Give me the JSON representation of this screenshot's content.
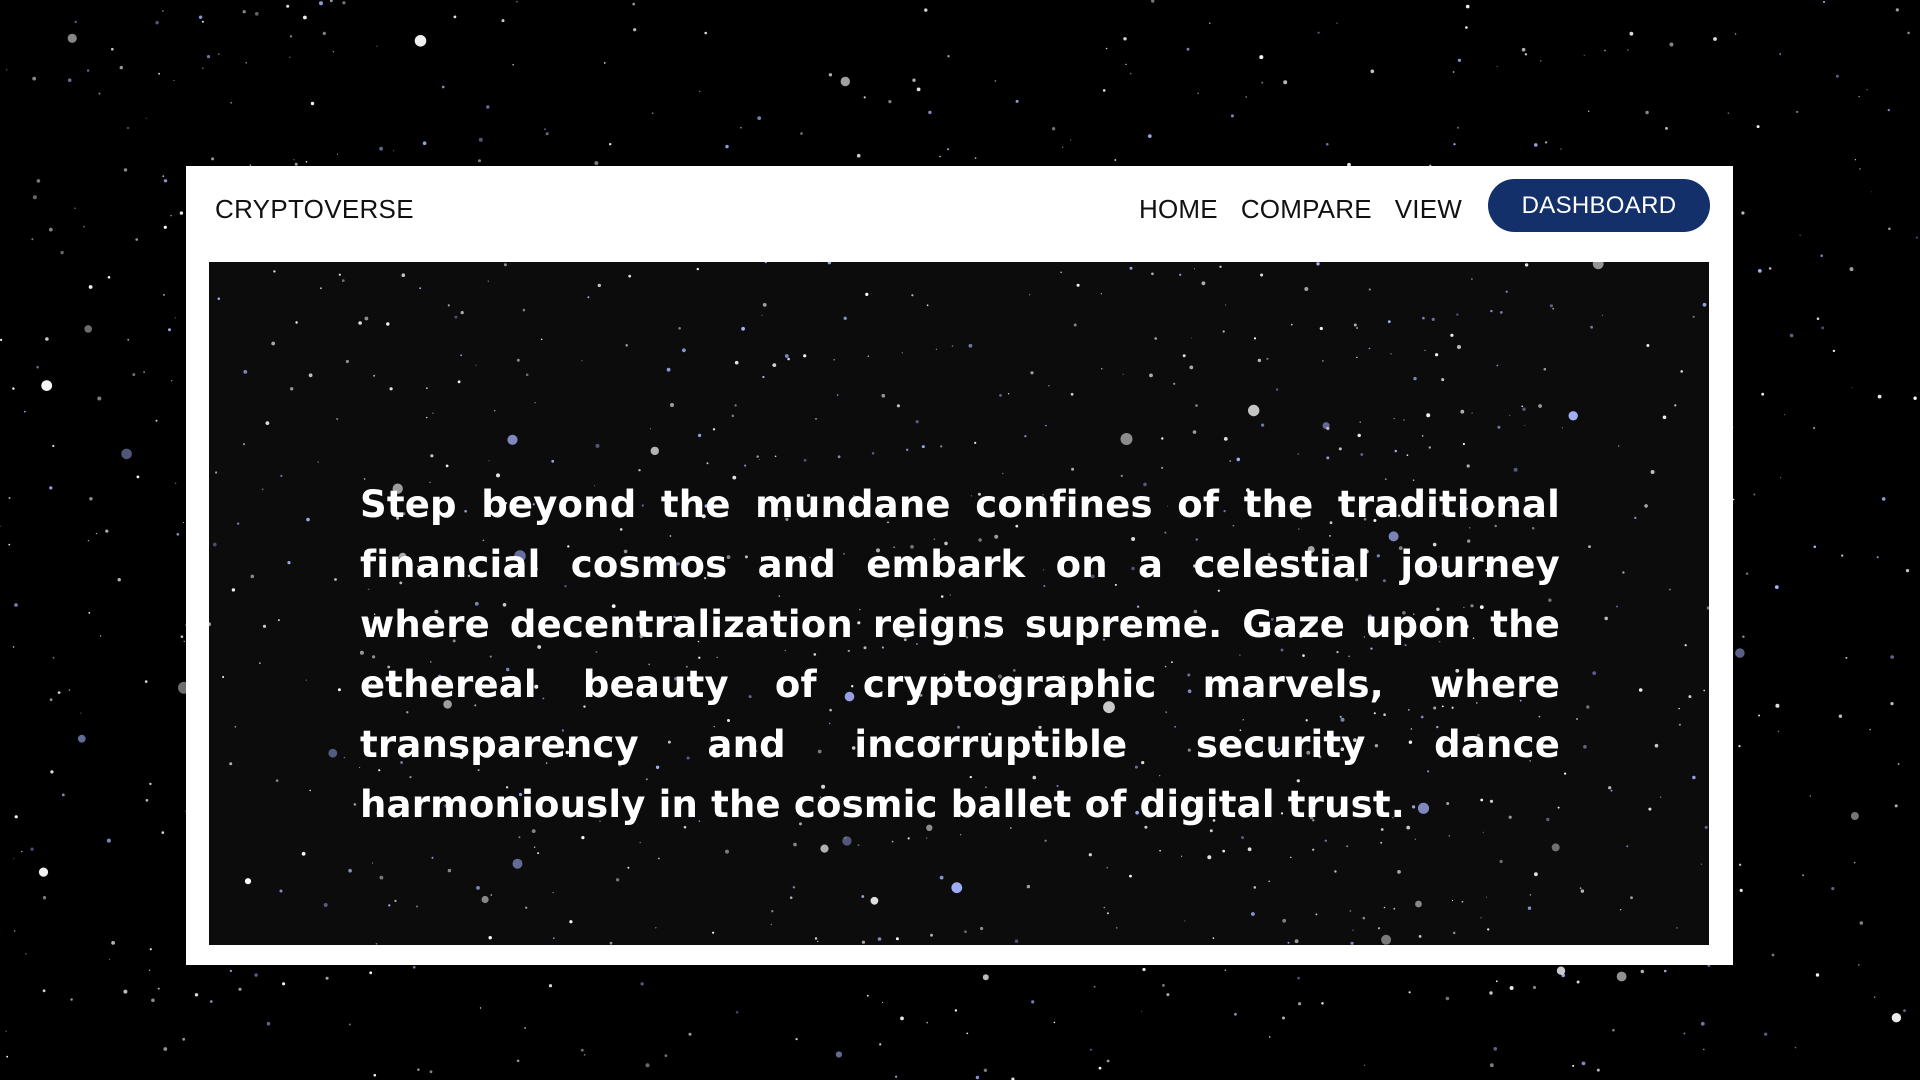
{
  "brand": {
    "name": "CRYPTOVERSE"
  },
  "nav": {
    "items": [
      {
        "label": "HOME"
      },
      {
        "label": "COMPARE"
      },
      {
        "label": "VIEW"
      }
    ],
    "dashboard_label": "DASHBOARD"
  },
  "hero": {
    "text": "Step beyond the mundane confines of the traditional financial cosmos and embark on a celestial journey where decentralization reigns supreme. Gaze upon the ethereal beauty of cryptographic marvels, where transparency and incorruptible security dance harmoniously in the cosmic ballet of digital trust."
  },
  "colors": {
    "page_background": "#000000",
    "card_background": "#ffffff",
    "hero_background": "#0c0c0d",
    "accent_button": "#13306b",
    "star_white": "#ffffff",
    "star_blue": "#a8b4ff"
  }
}
